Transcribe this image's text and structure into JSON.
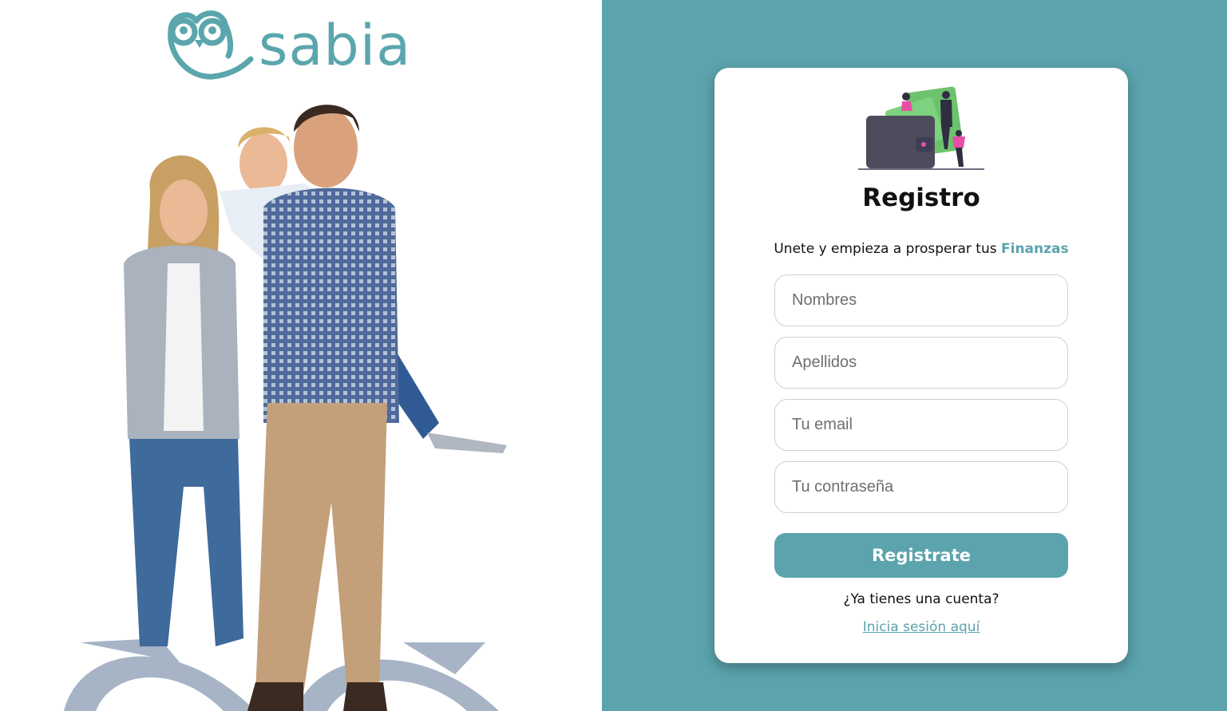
{
  "brand": {
    "name": "sabia",
    "color": "#5ba6ad"
  },
  "colors": {
    "panel_background": "#5ba3ad",
    "button": "#5ba3ad",
    "accent": "#5ba3ad"
  },
  "register": {
    "title": "Registro",
    "subtitle_prefix": "Unete y empieza a prosperar tus",
    "subtitle_highlight": "Finanzas",
    "fields": {
      "first_name_placeholder": "Nombres",
      "last_name_placeholder": "Apellidos",
      "email_placeholder": "Tu email",
      "password_placeholder": "Tu contraseña"
    },
    "submit_label": "Registrate",
    "account_question": "¿Ya tienes una cuenta?",
    "login_link": "Inicia sesión aquí"
  }
}
